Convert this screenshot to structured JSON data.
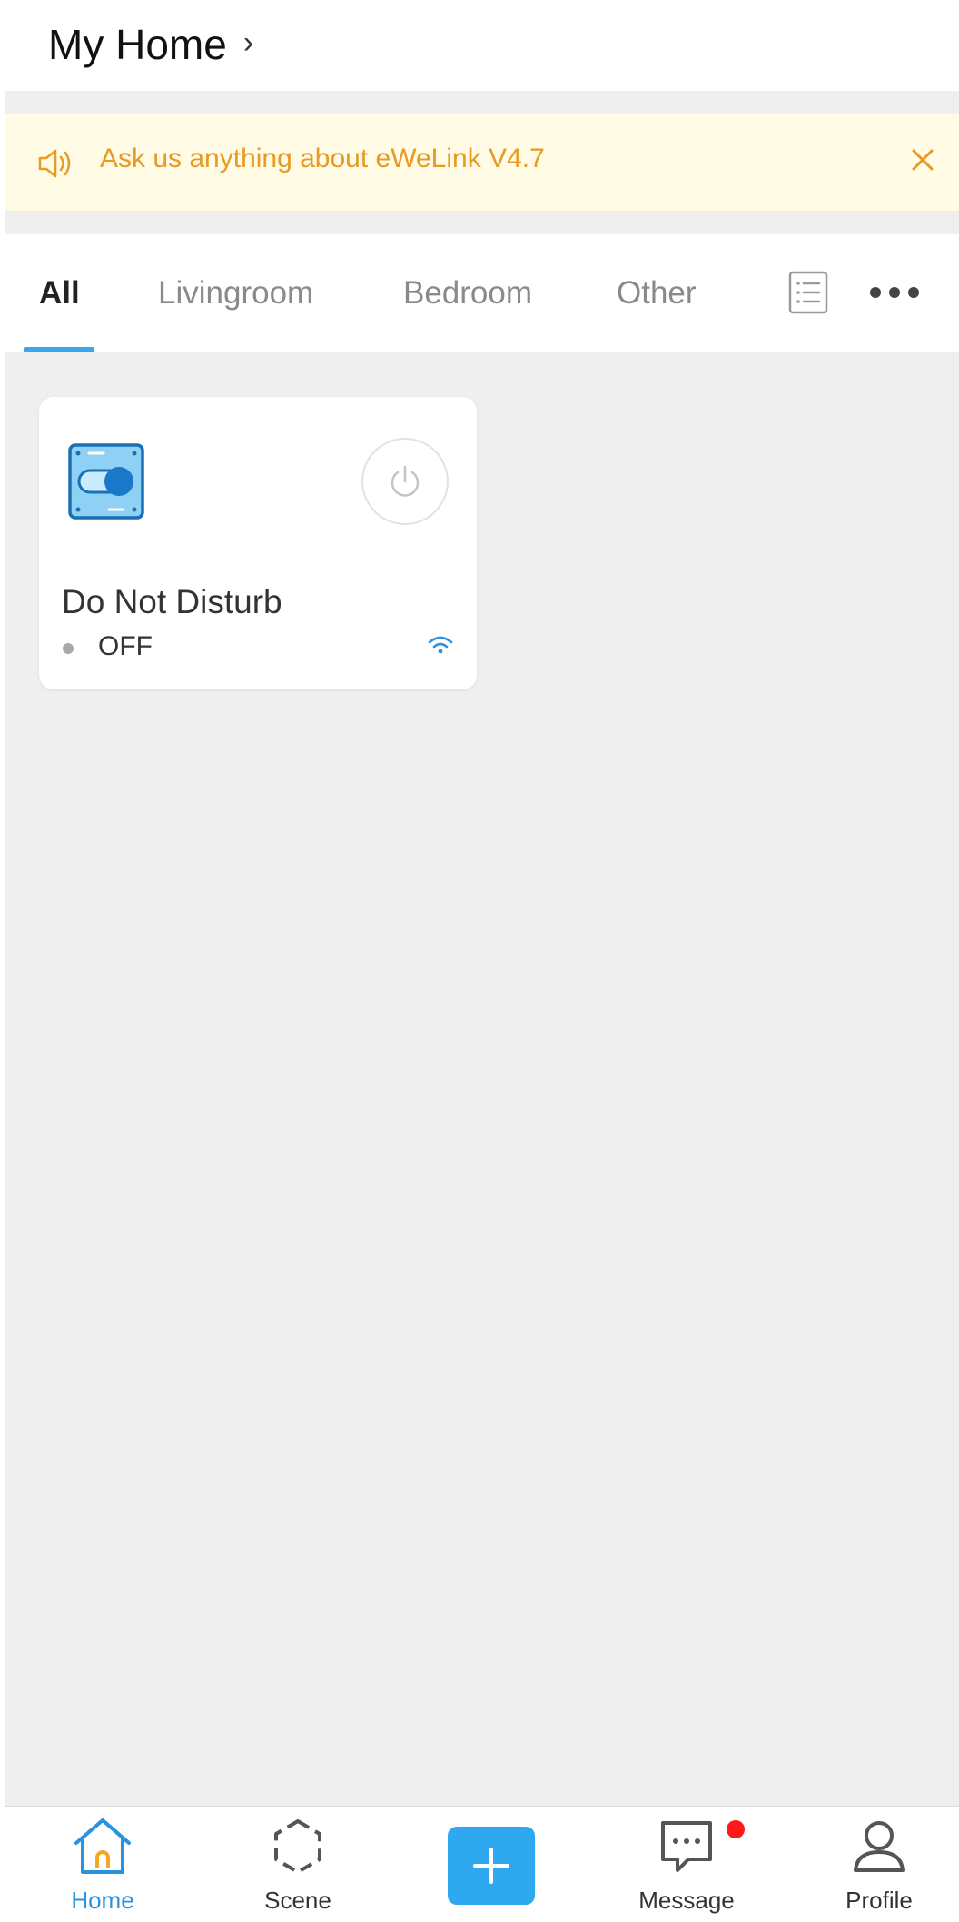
{
  "header": {
    "title": "My Home",
    "chevron": "›"
  },
  "banner": {
    "text": "Ask us anything about eWeLink V4.7",
    "icon": "speaker-icon",
    "close_icon": "close-icon",
    "color": "#e89a22",
    "background": "#fffbe5"
  },
  "tabs": {
    "items": [
      {
        "label": "All",
        "active": true
      },
      {
        "label": "Livingroom",
        "active": false
      },
      {
        "label": "Bedroom",
        "active": false
      },
      {
        "label": "Other",
        "active": false
      }
    ],
    "list_icon": "list-view-icon",
    "more_icon": "more-options-icon",
    "accent": "#3aa6ec"
  },
  "devices": [
    {
      "name": "Do Not Disturb",
      "status": "OFF",
      "icon": "switch-device-icon",
      "power_icon": "power-icon",
      "connectivity_icon": "wifi-icon"
    }
  ],
  "bottom_nav": {
    "home": "Home",
    "scene": "Scene",
    "add_icon": "plus-icon",
    "message": "Message",
    "profile": "Profile",
    "active_color": "#2a93e0",
    "add_color": "#2ea9f0",
    "badge_color": "#ff1a1a"
  }
}
